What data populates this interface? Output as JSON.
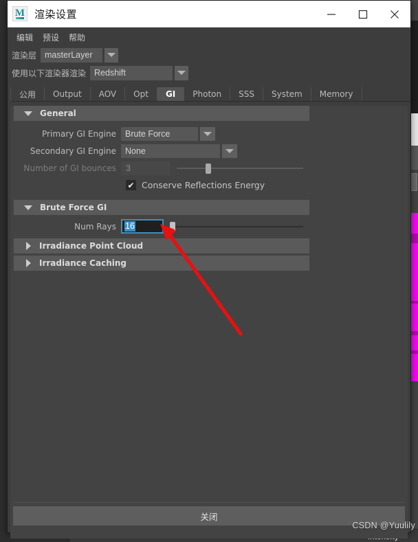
{
  "window": {
    "title": "渲染设置",
    "app_icon": "maya-icon",
    "controls": {
      "minimize": "minimize-icon",
      "maximize": "maximize-icon",
      "close": "close-icon"
    }
  },
  "menubar": {
    "items": [
      {
        "label": "编辑"
      },
      {
        "label": "预设"
      },
      {
        "label": "帮助"
      }
    ]
  },
  "top_fields": {
    "render_layer": {
      "label": "渲染层",
      "value": "masterLayer",
      "arrow": "chevron-down-icon"
    },
    "renderer": {
      "label": "使用以下渲染器渲染",
      "value": "Redshift",
      "arrow": "chevron-down-icon"
    }
  },
  "tabs": [
    {
      "label": "公用",
      "active": false
    },
    {
      "label": "Output",
      "active": false
    },
    {
      "label": "AOV",
      "active": false
    },
    {
      "label": "Opt",
      "active": false
    },
    {
      "label": "GI",
      "active": true
    },
    {
      "label": "Photon",
      "active": false
    },
    {
      "label": "SSS",
      "active": false
    },
    {
      "label": "System",
      "active": false
    },
    {
      "label": "Memory",
      "active": false
    }
  ],
  "sections": {
    "general": {
      "title": "General",
      "expanded": true,
      "primary_gi_engine": {
        "label": "Primary GI Engine",
        "value": "Brute Force"
      },
      "secondary_gi_engine": {
        "label": "Secondary GI Engine",
        "value": "None"
      },
      "gi_bounces": {
        "label": "Number of GI bounces",
        "value": "3",
        "enabled": false,
        "slider_percent": 12
      },
      "conserve_reflections": {
        "label": "Conserve Reflections Energy",
        "checked": true,
        "check_glyph": "✔"
      }
    },
    "brute_force_gi": {
      "title": "Brute Force GI",
      "expanded": true,
      "num_rays": {
        "label": "Num Rays",
        "value": "16",
        "selected": true,
        "slider_percent": 1
      }
    },
    "irradiance_point_cloud": {
      "title": "Irradiance Point Cloud",
      "expanded": false
    },
    "irradiance_caching": {
      "title": "Irradiance Caching",
      "expanded": false
    }
  },
  "footer": {
    "close_label": "关闭"
  },
  "annotation": {
    "arrow_color": "#e81010",
    "name": "red-arrow-pointing-to-num-rays"
  },
  "watermark": {
    "text": "CSDN @Yuulily"
  },
  "background": {
    "status_label": "Intensity",
    "accent_magenta": "#f30af3"
  }
}
